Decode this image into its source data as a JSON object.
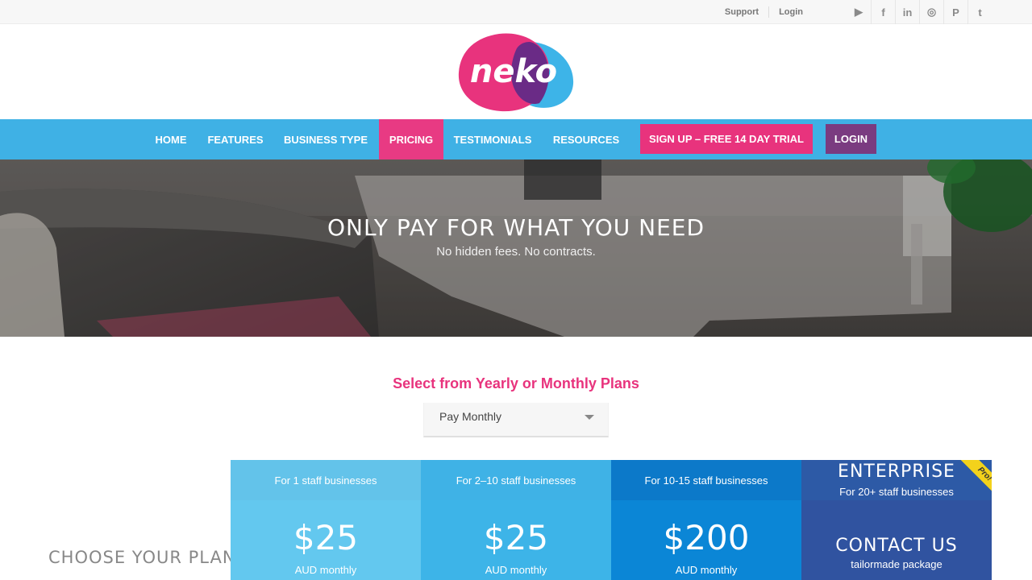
{
  "topbar": {
    "support": "Support",
    "login": "Login",
    "social": [
      "youtube-icon",
      "facebook-icon",
      "linkedin-icon",
      "instagram-icon",
      "pinterest-icon",
      "twitter-icon"
    ],
    "social_glyphs": [
      "▶",
      "f",
      "in",
      "◎",
      "P",
      "t"
    ]
  },
  "logo": {
    "text": "neko"
  },
  "nav": {
    "items": [
      "HOME",
      "FEATURES",
      "BUSINESS TYPE",
      "PRICING",
      "TESTIMONIALS",
      "RESOURCES"
    ],
    "active": "PRICING",
    "signup": "SIGN UP – FREE 14 DAY TRIAL",
    "login": "LOGIN"
  },
  "hero": {
    "title": "ONLY PAY FOR WHAT YOU NEED",
    "subtitle": "No hidden fees. No contracts."
  },
  "plans": {
    "heading": "Select from Yearly or Monthly Plans",
    "selected": "Pay Monthly",
    "choose_label": "CHOOSE YOUR PLAN",
    "columns": [
      {
        "head": "For 1 staff businesses",
        "price": "$25",
        "unit": "AUD monthly"
      },
      {
        "head": "For 2–10 staff businesses",
        "price": "$25",
        "unit": "AUD monthly"
      },
      {
        "head": "For 10-15 staff businesses",
        "price": "$200",
        "unit": "AUD monthly"
      }
    ],
    "enterprise": {
      "title": "ENTERPRISE",
      "sub": "For 20+ staff businesses",
      "cta": "CONTACT US",
      "note": "tailormade package",
      "ribbon": "Pro!"
    }
  },
  "colors": {
    "nav_blue": "#3fb1e5",
    "accent_pink": "#e8337d",
    "login_purple": "#7a3b80"
  }
}
